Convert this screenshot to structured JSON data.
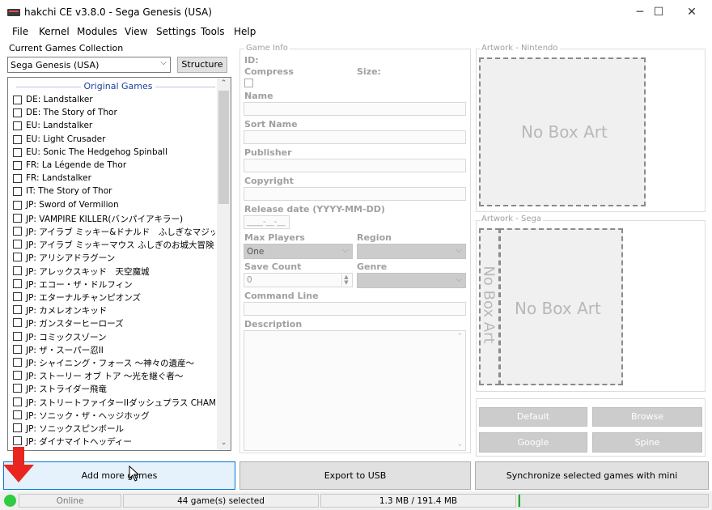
{
  "window": {
    "title": "hakchi CE v3.8.0 - Sega Genesis (USA)",
    "minimize": "─",
    "maximize": "☐",
    "close": "✕"
  },
  "menu": [
    "File",
    "Kernel",
    "Modules",
    "View",
    "Settings",
    "Tools",
    "Help"
  ],
  "collection": {
    "label": "Current Games Collection",
    "selected": "Sega Genesis (USA)",
    "structure_button": "Structure"
  },
  "games": {
    "group_title": "Original Games",
    "items": [
      "DE: Landstalker",
      "DE: The Story of Thor",
      "EU: Landstalker",
      "EU: Light Crusader",
      "EU: Sonic The Hedgehog Spinball",
      "FR: La Légende de Thor",
      "FR: Landstalker",
      "IT: The Story of Thor",
      "JP: Sword of Vermilion",
      "JP: VAMPIRE KILLER(バンパイアキラー)",
      "JP: アイラブ ミッキー&ドナルド　ふしぎなマジックボッ...",
      "JP: アイラブ ミッキーマウス ふしぎのお城大冒険",
      "JP: アリシアドラグーン",
      "JP: アレックスキッド　天空魔城",
      "JP: エコー・ザ・ドルフィン",
      "JP: エターナルチャンピオンズ",
      "JP: カメレオンキッド",
      "JP: ガンスターヒーローズ",
      "JP: コミックスゾーン",
      "JP: ザ・スーパー忍II",
      "JP: シャイニング・フォース ～神々の遺産～",
      "JP: ストーリー オブ トア ～光を継ぐ者～",
      "JP: ストライダー飛竜",
      "JP: ストリートファイターIIダッシュプラス CHAMPION E...",
      "JP: ソニック・ザ・ヘッジホッグ",
      "JP: ソニックスピンボール",
      "JP: ダイナマイトヘッディー"
    ]
  },
  "game_info": {
    "title": "Game Info",
    "id_label": "ID:",
    "compress_label": "Compress",
    "size_label": "Size:",
    "name_label": "Name",
    "sort_name_label": "Sort Name",
    "publisher_label": "Publisher",
    "copyright_label": "Copyright",
    "release_label": "Release date (YYYY-MM-DD)",
    "release_value": "____-__-__",
    "max_players_label": "Max Players",
    "max_players_value": "One",
    "region_label": "Region",
    "save_count_label": "Save Count",
    "save_count_value": "0",
    "genre_label": "Genre",
    "command_line_label": "Command Line",
    "description_label": "Description"
  },
  "artwork": {
    "nintendo_title": "Artwork - Nintendo",
    "sega_title": "Artwork - Sega",
    "no_box_art": "No Box Art",
    "default_button": "Default",
    "browse_button": "Browse",
    "google_button": "Google",
    "spine_button": "Spine"
  },
  "actions": {
    "add_games": "Add more games",
    "export_usb": "Export to USB",
    "sync": "Synchronize selected games with mini"
  },
  "status": {
    "online": "Online",
    "selected": "44 game(s) selected",
    "size": "1.3 MB / 191.4 MB",
    "indicator_color": "#2ecc40"
  }
}
